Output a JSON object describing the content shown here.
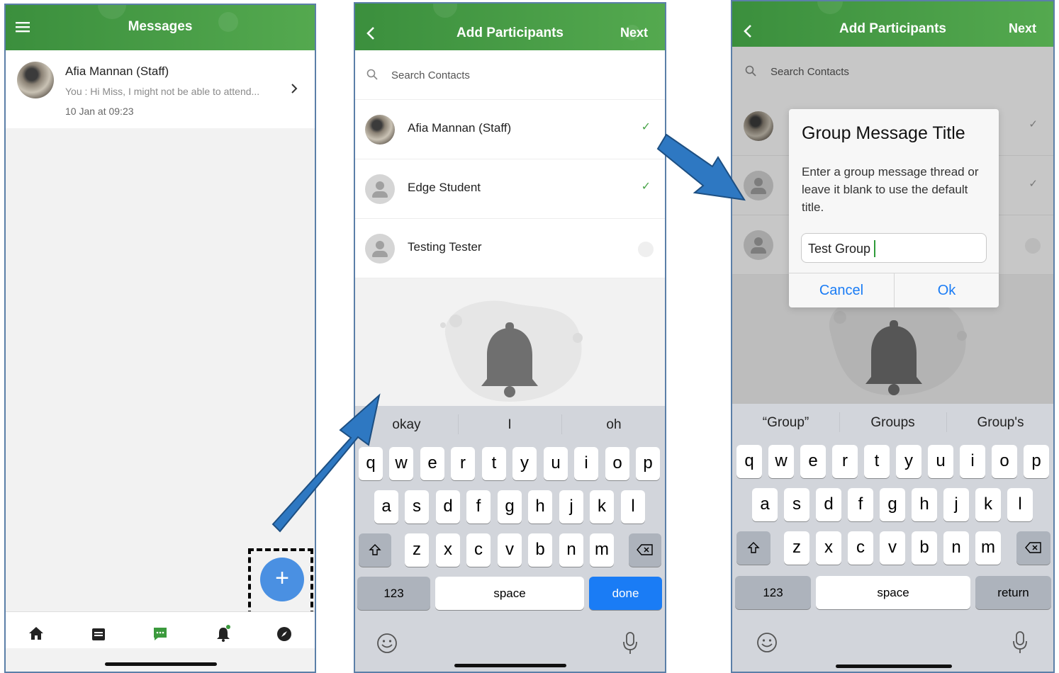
{
  "screen1": {
    "title": "Messages",
    "message": {
      "name": "Afia Mannan (Staff)",
      "preview": "You : Hi Miss, I might not be able to attend...",
      "time": "10 Jan at 09:23"
    },
    "fab_label": "+",
    "nav": [
      "home-icon",
      "calendar-icon",
      "messages-icon",
      "bell-icon",
      "compass-icon"
    ]
  },
  "screen2": {
    "back": "<",
    "title": "Add Participants",
    "next": "Next",
    "search_placeholder": "Search Contacts",
    "contacts": [
      {
        "name": "Afia Mannan (Staff)",
        "selected": true
      },
      {
        "name": "Edge Student",
        "selected": true
      },
      {
        "name": "Testing Tester",
        "selected": false
      }
    ],
    "suggestions": [
      "okay",
      "I",
      "oh"
    ],
    "keyboard": {
      "row1": [
        "q",
        "w",
        "e",
        "r",
        "t",
        "y",
        "u",
        "i",
        "o",
        "p"
      ],
      "row2": [
        "a",
        "s",
        "d",
        "f",
        "g",
        "h",
        "j",
        "k",
        "l"
      ],
      "row3": [
        "z",
        "x",
        "c",
        "v",
        "b",
        "n",
        "m"
      ],
      "numbers": "123",
      "space": "space",
      "action": "done"
    }
  },
  "screen3": {
    "back": "<",
    "title": "Add Participants",
    "next": "Next",
    "search_placeholder": "Search Contacts",
    "dialog": {
      "title": "Group Message Title",
      "body": "Enter a group message thread or leave it blank to use the default title.",
      "input_value": "Test Group",
      "cancel": "Cancel",
      "ok": "Ok"
    },
    "suggestions": [
      "“Group”",
      "Groups",
      "Group's"
    ],
    "keyboard": {
      "numbers": "123",
      "space": "space",
      "action": "return"
    }
  },
  "colors": {
    "header_green": "#46a046",
    "fab_blue": "#4a90e2",
    "arrow_blue": "#2e78c2",
    "check_green": "#4aa54a",
    "ios_blue": "#1a7cf5"
  }
}
